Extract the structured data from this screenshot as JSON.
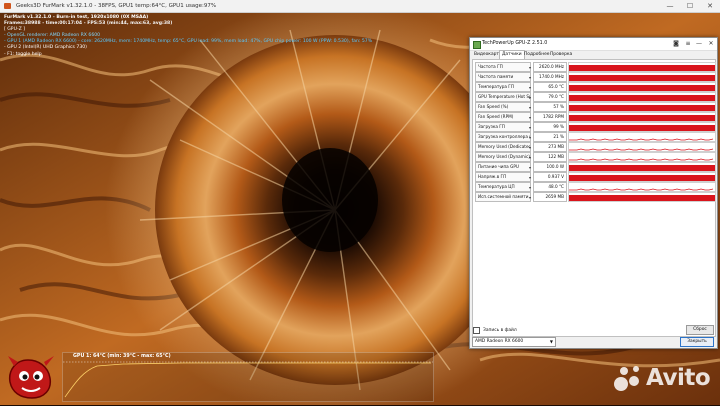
{
  "furmark_window": {
    "title": "Geeks3D FurMark v1.32.1.0 - 38FPS, GPU1 temp:64°C, GPU1 usage:97%"
  },
  "osd": {
    "line1": "FurMark v1.32.1.0 - Burn-in test, 1920x1080 (0X MSAA)",
    "line2": "Frames:38988 - time:00:17:04 - FPS:53 (min:44, max:63, avg:38)",
    "line3": "[ GPU-Z ]",
    "line4": "- OpenGL renderer: AMD Radeon RX 6600",
    "line5": "- GPU 1 (AMD Radeon RX 6600) - core: 2620MHz, mem: 1740MHz, temp: 65°C, GPU load: 99%, mem load: 47%, GPU chip power: 100 W (PPW: 0.530), fan: 57%",
    "line6": "- GPU 2 (Intel(R) UHD Graphics 730)",
    "line7": "- F1: toggle help"
  },
  "temp_graph": {
    "label": "GPU 1: 64°C (min: 39°C - max: 65°C)"
  },
  "logo": {
    "text": "FurMark"
  },
  "watermark": {
    "text": "Avito"
  },
  "gpuz": {
    "title": "TechPowerUp GPU-Z 2.51.0",
    "window_controls": [
      "—",
      "☐",
      "✕"
    ],
    "tabs": [
      {
        "label": "Видеокарта",
        "active": false
      },
      {
        "label": "Датчики",
        "active": true
      },
      {
        "label": "Подробнее",
        "active": false
      },
      {
        "label": "Проверка",
        "active": false
      }
    ],
    "sensors": [
      {
        "name": "Частота ГП",
        "value": "2620.0 MHz",
        "level": 0.9
      },
      {
        "name": "Частота памяти",
        "value": "1740.0 MHz",
        "level": 0.9
      },
      {
        "name": "Температура ГП",
        "value": "65.0 °C",
        "level": 0.9
      },
      {
        "name": "GPU Temperature (Hot Spot)",
        "value": "79.0 °C",
        "level": 0.9
      },
      {
        "name": "Fan Speed (%)",
        "value": "57 %",
        "level": 0.9
      },
      {
        "name": "Fan Speed (RPM)",
        "value": "1782 RPM",
        "level": 0.9
      },
      {
        "name": "Загрузка ГП",
        "value": "99 %",
        "level": 0.9
      },
      {
        "name": "Загрузка контроллера памяти",
        "value": "21 %",
        "level": 0.15
      },
      {
        "name": "Memory Used (Dedicated)",
        "value": "273 MB",
        "level": 0.1
      },
      {
        "name": "Memory Used (Dynamic)",
        "value": "122 MB",
        "level": 0.05
      },
      {
        "name": "Питание чипа GPU",
        "value": "100.0 W",
        "level": 0.9
      },
      {
        "name": "Напряж.в ГП",
        "value": "0.937 V",
        "level": 0.9
      },
      {
        "name": "Температура ЦП",
        "value": "48.0 °C",
        "level": 0.2
      },
      {
        "name": "Исп.системной памяти",
        "value": "2659 MB",
        "level": 0.9
      }
    ],
    "log_to_file_label": "Запись в файл",
    "reset_label": "Сброс",
    "gpu_selected": "AMD Radeon RX 6600",
    "close_label": "Закрыть"
  },
  "colors": {
    "sensor_bar": "#d9141c",
    "osd_cyan": "#58c9ff",
    "fur_orange": "#d6741e"
  }
}
